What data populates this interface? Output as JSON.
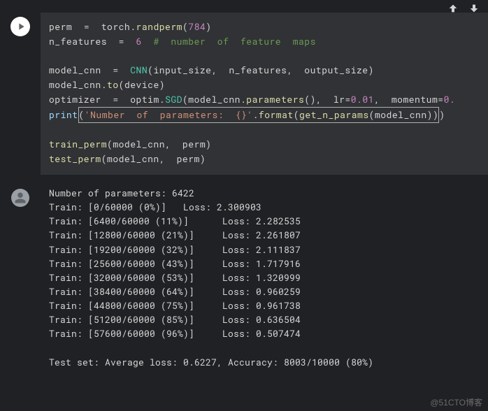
{
  "toolbar": {
    "up_icon": "arrow-up",
    "down_icon": "arrow-down"
  },
  "code": {
    "l1": {
      "a": "perm  ",
      "b": "=",
      "c": "  torch",
      "d": ".",
      "e": "randperm",
      "f": "(",
      "g": "784",
      "h": ")"
    },
    "l2": {
      "a": "n_features  ",
      "b": "=",
      "c": "  ",
      "d": "6",
      "e": "  ",
      "f": "#  number  of  feature  maps"
    },
    "l3": {
      "a": "model_cnn  ",
      "b": "=",
      "c": "  ",
      "d": "CNN",
      "e": "(input_size,  n_features,  output_size)"
    },
    "l4": {
      "a": "model_cnn",
      "b": ".",
      "c": "to",
      "d": "(device)"
    },
    "l5": {
      "a": "optimizer  ",
      "b": "=",
      "c": "  optim",
      "d": ".",
      "e": "SGD",
      "f": "(model_cnn",
      "g": ".",
      "h": "parameters",
      "i": "(),  lr",
      "j": "=",
      "k": "0.01",
      "l": ",  momentum",
      "m": "=",
      "n": "0."
    },
    "l6": {
      "a": "print",
      "b": "(",
      "c": "'Number  of  parameters:  {}'",
      "d": ".",
      "e": "format",
      "f": "(",
      "g": "get_n_params",
      "h": "(model_cnn))",
      "i": ")"
    },
    "l7": {
      "a": "train_perm",
      "b": "(model_cnn,  perm)"
    },
    "l8": {
      "a": "test_perm",
      "b": "(model_cnn,  perm)"
    }
  },
  "output": {
    "params": "Number of parameters: 6422",
    "train0": "Train: [0/60000 (0%)]   Loss: 2.300903",
    "rows": [
      {
        "label": "Train: [6400/60000 (11%)]",
        "loss": "Loss: 2.282535"
      },
      {
        "label": "Train: [12800/60000 (21%)]",
        "loss": "Loss: 2.261807"
      },
      {
        "label": "Train: [19200/60000 (32%)]",
        "loss": "Loss: 2.111837"
      },
      {
        "label": "Train: [25600/60000 (43%)]",
        "loss": "Loss: 1.717916"
      },
      {
        "label": "Train: [32000/60000 (53%)]",
        "loss": "Loss: 1.320999"
      },
      {
        "label": "Train: [38400/60000 (64%)]",
        "loss": "Loss: 0.960259"
      },
      {
        "label": "Train: [44800/60000 (75%)]",
        "loss": "Loss: 0.961738"
      },
      {
        "label": "Train: [51200/60000 (85%)]",
        "loss": "Loss: 0.636504"
      },
      {
        "label": "Train: [57600/60000 (96%)]",
        "loss": "Loss: 0.507474"
      }
    ],
    "test": "Test set: Average loss: 0.6227, Accuracy: 8003/10000 (80%)"
  },
  "watermark": "@51CTO博客"
}
